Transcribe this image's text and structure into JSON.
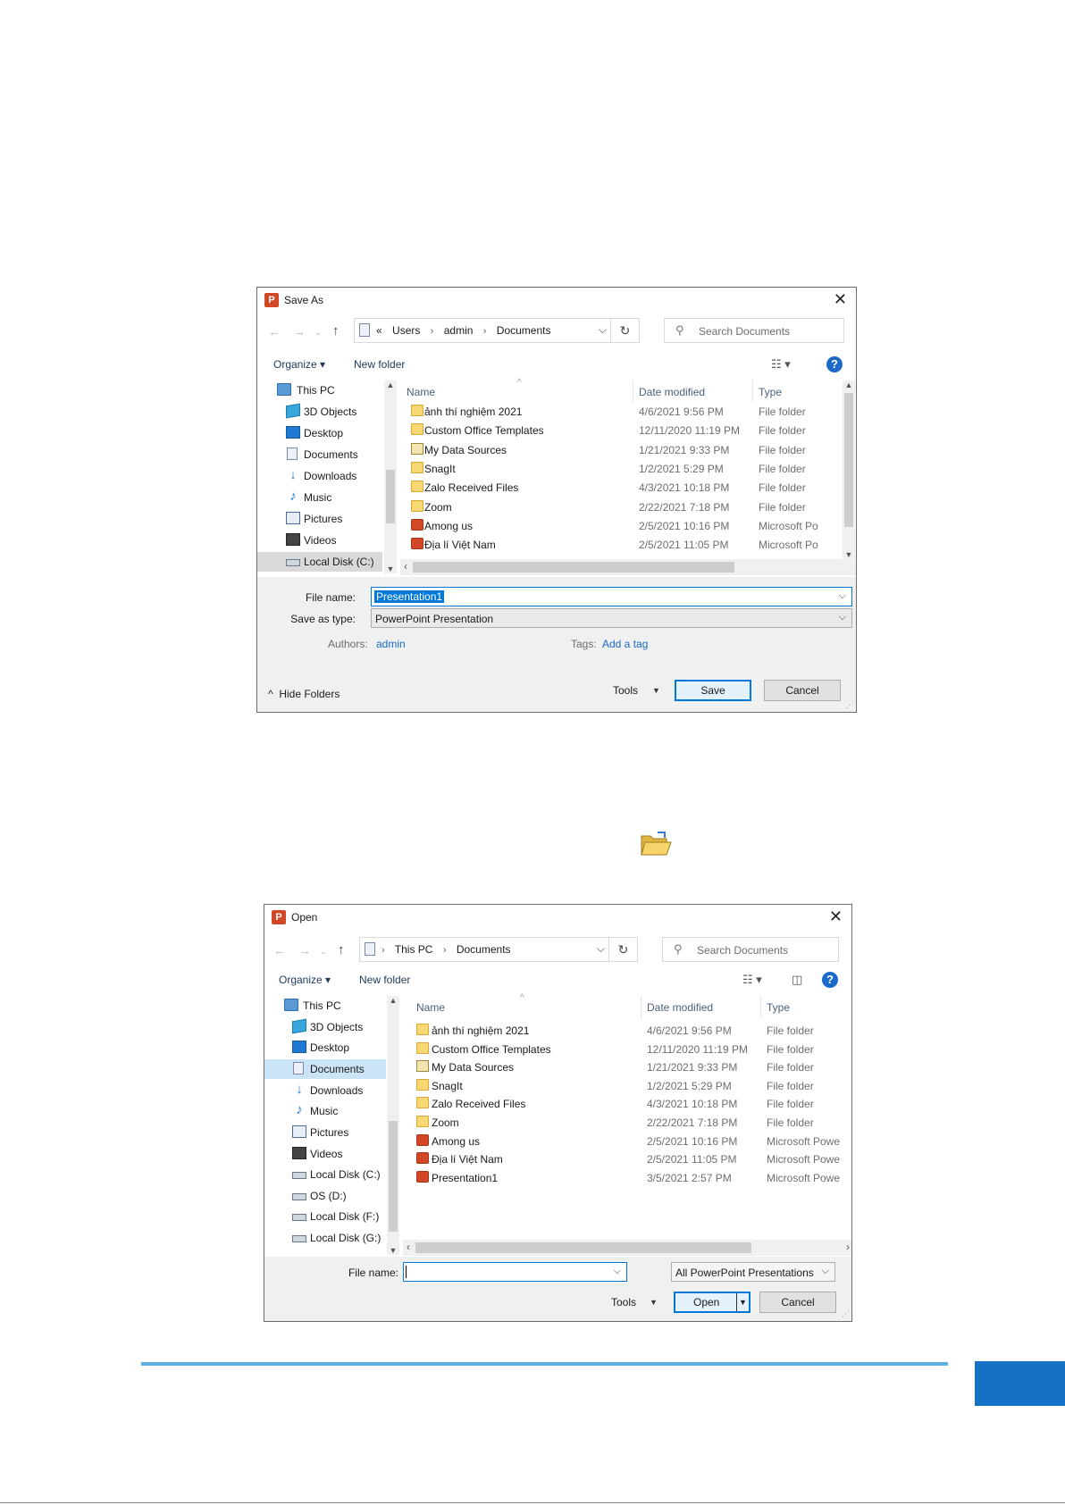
{
  "save_dialog": {
    "title": "Save As",
    "breadcrumb": [
      "«",
      "Users",
      "admin",
      "Documents"
    ],
    "search_placeholder": "Search Documents",
    "toolbar": {
      "organize": "Organize",
      "new_folder": "New folder"
    },
    "tree": [
      "This PC",
      "3D Objects",
      "Desktop",
      "Documents",
      "Downloads",
      "Music",
      "Pictures",
      "Videos",
      "Local Disk (C:)"
    ],
    "columns": {
      "name": "Name",
      "date": "Date modified",
      "type": "Type"
    },
    "files": [
      {
        "name": "ảnh thí nghiệm 2021",
        "date": "4/6/2021 9:56 PM",
        "type": "File folder",
        "icon": "folder"
      },
      {
        "name": "Custom Office Templates",
        "date": "12/11/2020 11:19 PM",
        "type": "File folder",
        "icon": "folder"
      },
      {
        "name": "My Data Sources",
        "date": "1/21/2021 9:33 PM",
        "type": "File folder",
        "icon": "data-sources"
      },
      {
        "name": "SnagIt",
        "date": "1/2/2021 5:29 PM",
        "type": "File folder",
        "icon": "folder"
      },
      {
        "name": "Zalo Received Files",
        "date": "4/3/2021 10:18 PM",
        "type": "File folder",
        "icon": "folder"
      },
      {
        "name": "Zoom",
        "date": "2/22/2021 7:18 PM",
        "type": "File folder",
        "icon": "folder"
      },
      {
        "name": "Among us",
        "date": "2/5/2021 10:16 PM",
        "type": "Microsoft Po",
        "icon": "powerpoint"
      },
      {
        "name": "Địa lí Việt Nam",
        "date": "2/5/2021 11:05 PM",
        "type": "Microsoft Po",
        "icon": "powerpoint"
      }
    ],
    "file_name_label": "File name:",
    "file_name_value": "Presentation1",
    "save_type_label": "Save as type:",
    "save_type_value": "PowerPoint Presentation",
    "authors_label": "Authors:",
    "authors_value": "admin",
    "tags_label": "Tags:",
    "tags_value": "Add a tag",
    "hide_folders": "Hide Folders",
    "tools": "Tools",
    "save_button": "Save",
    "cancel_button": "Cancel"
  },
  "open_dialog": {
    "title": "Open",
    "breadcrumb": [
      "This PC",
      "Documents"
    ],
    "search_placeholder": "Search Documents",
    "toolbar": {
      "organize": "Organize",
      "new_folder": "New folder"
    },
    "tree": [
      "This PC",
      "3D Objects",
      "Desktop",
      "Documents",
      "Downloads",
      "Music",
      "Pictures",
      "Videos",
      "Local Disk (C:)",
      "OS (D:)",
      "Local Disk (F:)",
      "Local Disk (G:)"
    ],
    "columns": {
      "name": "Name",
      "date": "Date modified",
      "type": "Type"
    },
    "files": [
      {
        "name": "ảnh thí nghiệm 2021",
        "date": "4/6/2021 9:56 PM",
        "type": "File folder",
        "icon": "folder"
      },
      {
        "name": "Custom Office Templates",
        "date": "12/11/2020 11:19 PM",
        "type": "File folder",
        "icon": "folder"
      },
      {
        "name": "My Data Sources",
        "date": "1/21/2021 9:33 PM",
        "type": "File folder",
        "icon": "data-sources"
      },
      {
        "name": "SnagIt",
        "date": "1/2/2021 5:29 PM",
        "type": "File folder",
        "icon": "folder"
      },
      {
        "name": "Zalo Received Files",
        "date": "4/3/2021 10:18 PM",
        "type": "File folder",
        "icon": "folder"
      },
      {
        "name": "Zoom",
        "date": "2/22/2021 7:18 PM",
        "type": "File folder",
        "icon": "folder"
      },
      {
        "name": "Among us",
        "date": "2/5/2021 10:16 PM",
        "type": "Microsoft Powe",
        "icon": "powerpoint"
      },
      {
        "name": "Địa lí Việt Nam",
        "date": "2/5/2021 11:05 PM",
        "type": "Microsoft Powe",
        "icon": "powerpoint"
      },
      {
        "name": "Presentation1",
        "date": "3/5/2021 2:57 PM",
        "type": "Microsoft Powe",
        "icon": "powerpoint"
      }
    ],
    "file_name_label": "File name:",
    "file_name_value": "",
    "file_type_value": "All PowerPoint Presentations",
    "tools": "Tools",
    "open_button": "Open",
    "cancel_button": "Cancel"
  },
  "colors": {
    "accent": "#0078d7",
    "footer_line": "#5bb0e4",
    "footer_box": "#1571c5"
  }
}
